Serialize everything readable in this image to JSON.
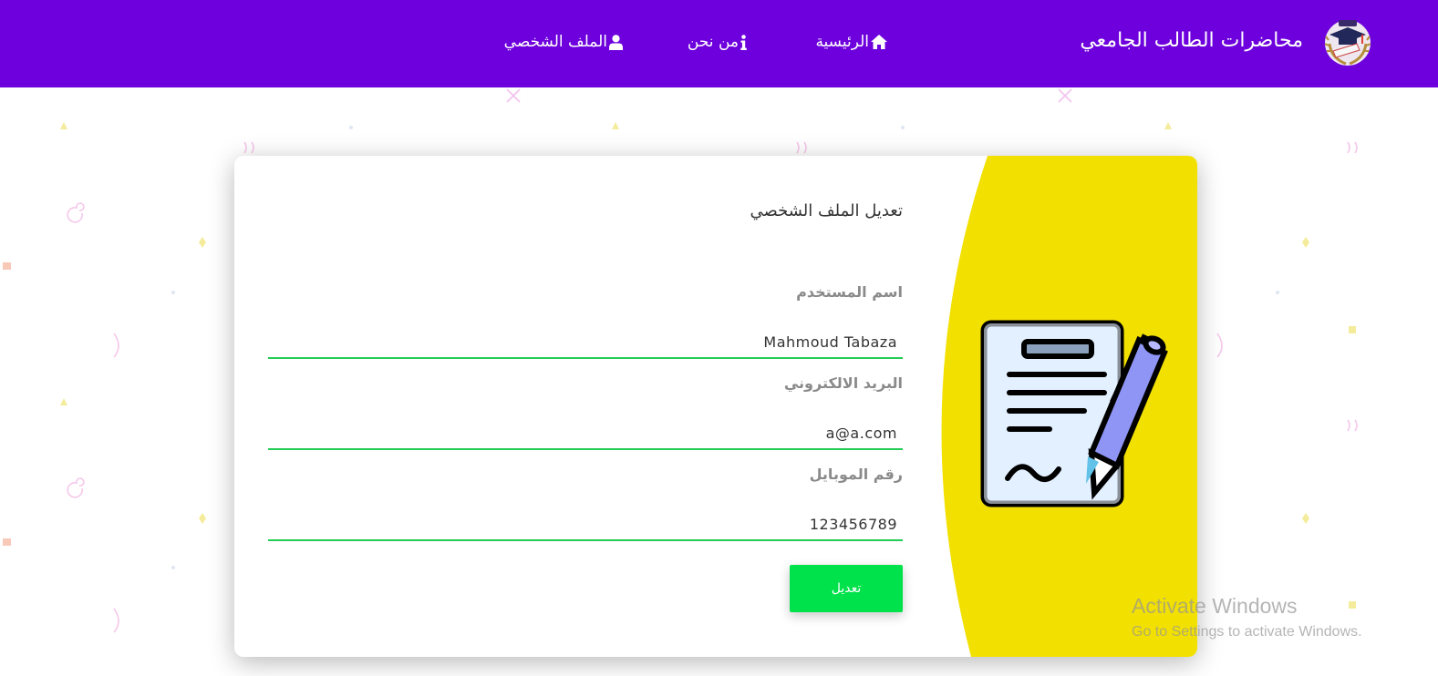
{
  "navbar": {
    "brand_title": "محاضرات الطالب الجامعي",
    "links": [
      {
        "label": "الرئيسية",
        "icon": "home-icon"
      },
      {
        "label": "من نحن",
        "icon": "info-icon"
      },
      {
        "label": "الملف الشخصي",
        "icon": "user-icon"
      }
    ],
    "background_color": "#6d00dc"
  },
  "form": {
    "title": "تعديل الملف الشخصي",
    "fields": [
      {
        "label": "اسم المستخدم",
        "value": "Mahmoud Tabaza"
      },
      {
        "label": "البريد الالكتروني",
        "value": "a@a.com"
      },
      {
        "label": "رقم الموبايل",
        "value": "123456789"
      }
    ],
    "submit_label": "تعديل",
    "accent_color": "#00e24b",
    "underline_color": "#22cc55"
  },
  "illustration": {
    "icon": "document-with-pen-icon",
    "panel_color": "#f2e000"
  },
  "watermark": {
    "title": "Activate Windows",
    "subtitle": "Go to Settings to activate Windows."
  }
}
